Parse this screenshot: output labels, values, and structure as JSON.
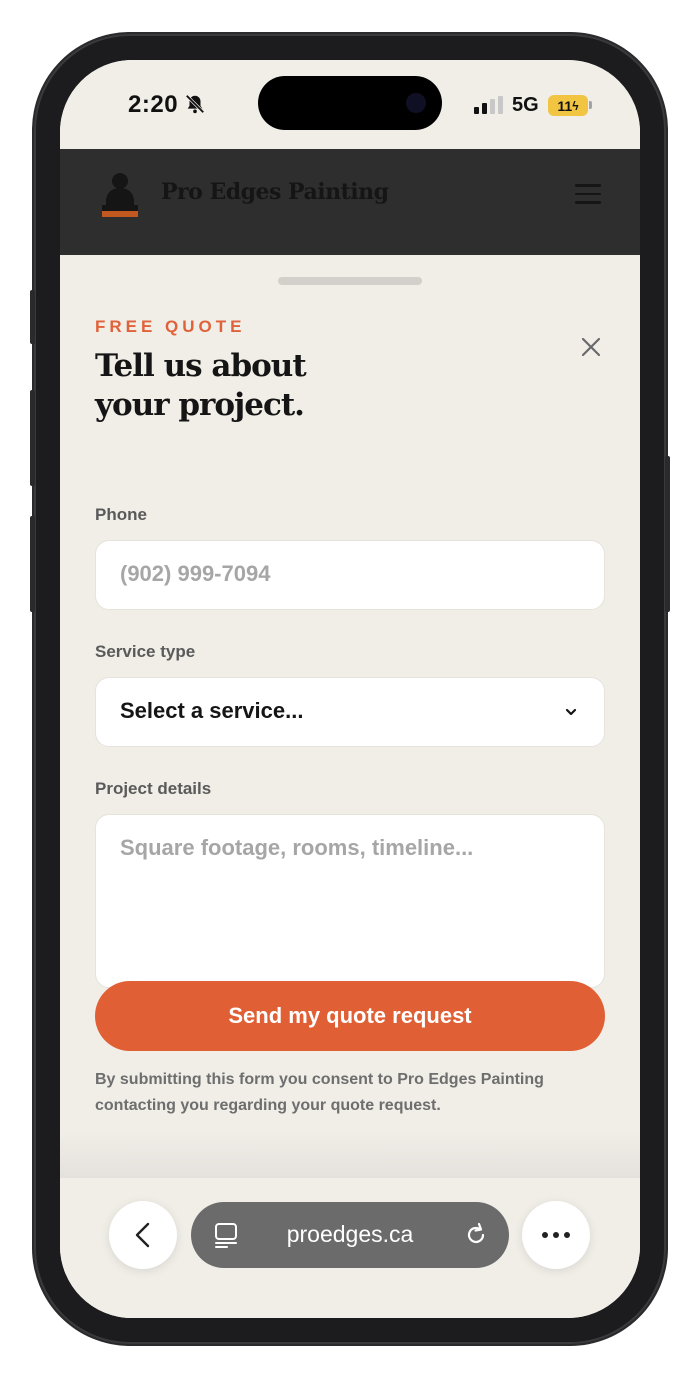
{
  "status_bar": {
    "time": "2:20",
    "network": "5G",
    "battery": "11"
  },
  "header": {
    "site_name": "Pro Edges Painting",
    "logo_text": "PRO EDGES PAINTING"
  },
  "quote_form": {
    "eyebrow": "FREE QUOTE",
    "title_line1": "Tell us about",
    "title_line2": "your project.",
    "phone_label": "Phone",
    "phone_placeholder": "(902) 999-7094",
    "service_label": "Service type",
    "service_value": "Select a service...",
    "details_label": "Project details",
    "details_placeholder": "Square footage, rooms, timeline...",
    "submit_label": "Send my quote request",
    "consent_text": "By submitting this form you consent to Pro Edges Painting contacting you regarding your quote request."
  },
  "browser": {
    "url": "proedges.ca"
  },
  "colors": {
    "accent": "#e05f35",
    "sheet_bg": "#f1eee8",
    "header_bg": "#2e2e2e"
  }
}
